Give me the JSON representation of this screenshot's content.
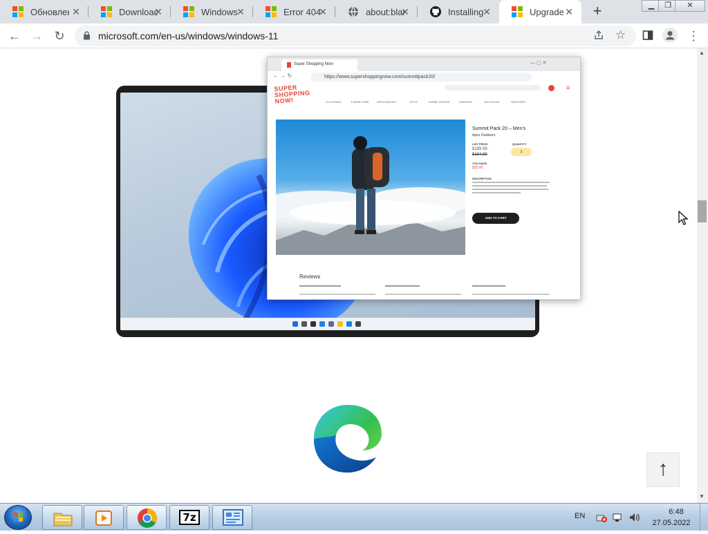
{
  "tabs": [
    {
      "title": "Обновлен",
      "icon": "microsoft-icon"
    },
    {
      "title": "Download",
      "icon": "microsoft-icon"
    },
    {
      "title": "Windows",
      "icon": "microsoft-icon"
    },
    {
      "title": "Error 404",
      "icon": "microsoft-icon"
    },
    {
      "title": "about:blar",
      "icon": "globe-icon"
    },
    {
      "title": "Installing",
      "icon": "github-icon"
    },
    {
      "title": "Upgrade",
      "icon": "microsoft-icon",
      "active": true
    }
  ],
  "toolbar": {
    "url": "microsoft.com/en-us/windows/windows-11"
  },
  "mock_browser": {
    "tab_title": "Super Shopping Now",
    "url": "https://www.supershoppingnow.com/summitpack20/",
    "brand": [
      "SUPER",
      "SHOPPING",
      "NOW!"
    ],
    "nav": [
      "CLOTHING",
      "FURNITURE",
      "APPLIANCES",
      "TOYS",
      "HOME GOODS",
      "GARDEN",
      "OUTDOOR",
      "GROCERY"
    ],
    "product_title": "Summit Pack 20 – Men’s",
    "product_brand": "Apex Outdoors",
    "list_price_label": "LIST PRICE:",
    "price": "$189.99",
    "old_price": "$194.99",
    "quantity_label": "QUANTITY",
    "quantity": "1",
    "you_save_label": "YOU SAVE:",
    "you_save": "$25.00",
    "description_label": "DESCRIPTION:",
    "add_to_cart": "ADD TO CART",
    "reviews_heading": "Reviews"
  },
  "taskbar": {
    "language": "EN",
    "time": "6:48",
    "date": "27.05.2022"
  },
  "colors": {
    "accent_red": "#e8463c",
    "edge_blue": "#0c59a4",
    "edge_green": "#35c04c"
  }
}
